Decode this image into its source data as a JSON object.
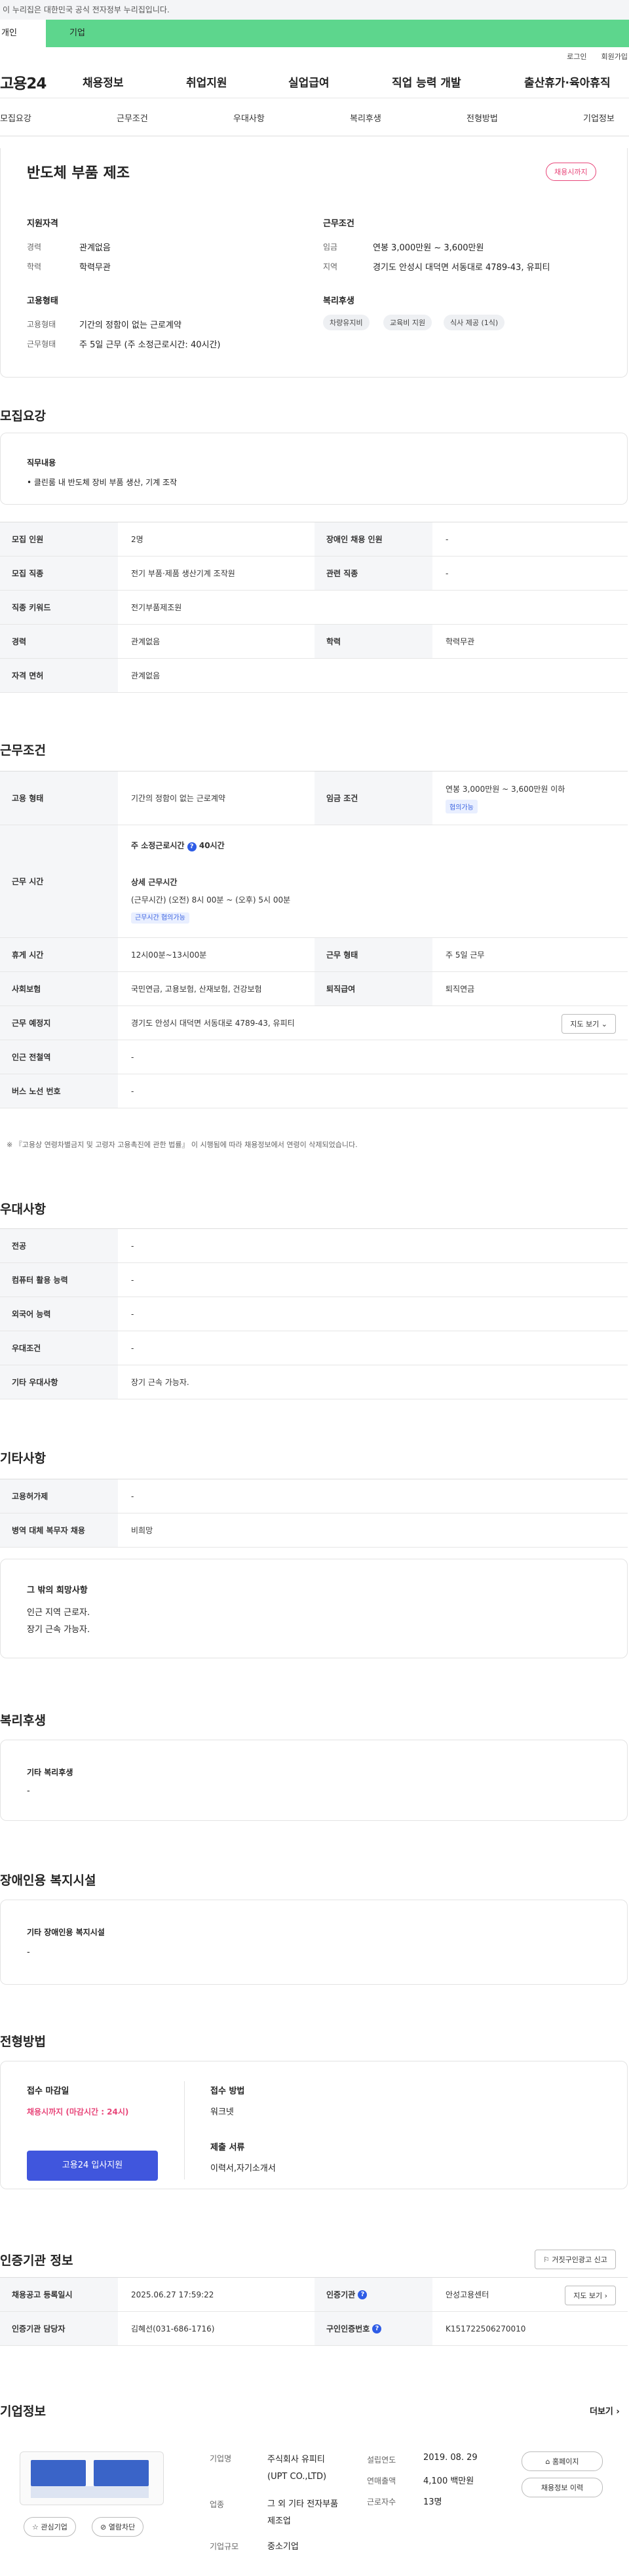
{
  "gov_banner": "이 누리집은 대한민국 공식 전자정부 누리집입니다.",
  "gov_tabs": [
    "개인",
    "기업"
  ],
  "util": [
    "로그인",
    "회원가입"
  ],
  "logo": "고용24",
  "menu": [
    "채용정보",
    "취업지원",
    "실업급여",
    "직업 능력 개발",
    "출산휴가·육아휴직"
  ],
  "subnav": [
    "모집요강",
    "근무조건",
    "우대사항",
    "복리후생",
    "전형방법",
    "기업정보"
  ],
  "hero": {
    "title": "반도체 부품 제조",
    "badge": "채용시까지",
    "support_h": "지원자격",
    "support": [
      {
        "k": "경력",
        "v": "관계없음"
      },
      {
        "k": "학력",
        "v": "학력무관"
      }
    ],
    "cond_h": "근무조건",
    "cond": [
      {
        "k": "임금",
        "v": "연봉 3,000만원 ~ 3,600만원"
      },
      {
        "k": "지역",
        "v": "경기도 안성시 대덕면 서동대로 4789-43, 유피티"
      }
    ],
    "emp_h": "고용형태",
    "emp": [
      {
        "k": "고용형태",
        "v": "기간의 정함이 없는 근로계약"
      },
      {
        "k": "근무형태",
        "v": "주 5일 근무 (주 소정근로시간: 40시간)"
      }
    ],
    "welfare_h": "복리후생",
    "welfare": [
      "차량유지비",
      "교육비 지원",
      "식사 제공 (1식)"
    ]
  },
  "recruit": {
    "title": "모집요강",
    "duty_h": "직무내용",
    "duty": "• 클린룸 내 반도체 장비 부품 생산, 기계 조작",
    "rows": [
      [
        "모집 인원",
        "2명",
        "장애인 채용 인원",
        "-"
      ],
      [
        "모집 직종",
        "전기 부품·제품 생산기계 조작원",
        "관련 직종",
        "-"
      ],
      [
        "직종 키워드",
        "전기부품제조원"
      ],
      [
        "경력",
        "관계없음",
        "학력",
        "학력무관"
      ],
      [
        "자격 면허",
        "관계없음"
      ]
    ]
  },
  "work": {
    "title": "근무조건",
    "emp_type_k": "고용 형태",
    "emp_type_v": "기간의 정함이 없는 근로계약",
    "wage_k": "임금 조건",
    "wage_v": "연봉 3,000만원 ~ 3,600만원 이하",
    "wage_tag": "협의가능",
    "hours_k": "근무 시간",
    "hours_week": "주 소정근로시간",
    "hours_week_v": "40시간",
    "hours_detail_h": "상세 근무시간",
    "hours_detail": "(근무시간) (오전) 8시 00분 ~ (오후) 5시 00분",
    "hours_tag": "근무시간 협의가능",
    "rows": [
      [
        "휴게 시간",
        "12시00분~13시00분",
        "근무 형태",
        "주 5일 근무"
      ],
      [
        "사회보험",
        "국민연금, 고용보험, 산재보험, 건강보험",
        "퇴직급여",
        "퇴직연금"
      ]
    ],
    "place_k": "근무 예정지",
    "place_v": "경기도 안성시 대덕면 서동대로 4789-43, 유피티",
    "map_btn": "지도 보기",
    "subway_k": "인근 전철역",
    "subway_v": "-",
    "bus_k": "버스 노선 번호",
    "bus_v": "-",
    "note": "※ 『고용상 연령차별금지 및 고령자 고용촉진에 관한 법률』 이 시행됨에 따라 채용정보에서 연령이 삭제되었습니다."
  },
  "pref": {
    "title": "우대사항",
    "rows": [
      [
        "전공",
        "-"
      ],
      [
        "컴퓨터 활용 능력",
        "-"
      ],
      [
        "외국어 능력",
        "-"
      ],
      [
        "우대조건",
        "-"
      ],
      [
        "기타 우대사항",
        "장기 근속 가능자."
      ]
    ]
  },
  "etc": {
    "title": "기타사항",
    "rows": [
      [
        "고용허가제",
        "-"
      ],
      [
        "병역 대체 복무자 채용",
        "비희망"
      ]
    ],
    "wish_h": "그 밖의 희망사항",
    "wish": [
      "인근 지역 근로자.",
      "장기 근속 가능자."
    ]
  },
  "benefit": {
    "title": "복리후생",
    "h": "기타 복리후생",
    "v": "-"
  },
  "disab": {
    "title": "장애인용 복지시설",
    "h": "기타 장애인용 복지시설",
    "v": "-"
  },
  "select": {
    "title": "전형방법",
    "deadline_h": "접수 마감일",
    "deadline": "채용시까지 (마감시간 : 24시)",
    "apply": "고용24 입사지원",
    "method_h": "접수 방법",
    "method": "워크넷",
    "docs_h": "제출 서류",
    "docs": "이력서,자기소개서"
  },
  "agency": {
    "title": "인증기관 정보",
    "report": "거짓구인광고 신고",
    "rows": [
      [
        "채용공고 등록일시",
        "2025.06.27 17:59:22",
        "인증기관",
        "안성고용센터"
      ],
      [
        "인증기관 담당자",
        "김혜선(031-686-1716)",
        "구인인증번호",
        "K151722506270010"
      ]
    ],
    "map_btn": "지도 보기"
  },
  "company": {
    "title": "기업정보",
    "more": "더보기",
    "like": "관심기업",
    "block": "열람차단",
    "name_k": "기업명",
    "name_v": "주식회사 유피티 (UPT CO.,LTD)",
    "ind_k": "업종",
    "ind_v": "그 외 기타 전자부품 제조업",
    "size_k": "기업규모",
    "size_v": "중소기업",
    "year_k": "설립연도",
    "year_v": "2019. 08. 29",
    "sales_k": "연매출액",
    "sales_v": "4,100 백만원",
    "emp_k": "근로자수",
    "emp_v": "13명",
    "home": "홈페이지",
    "history": "채용정보 이력"
  }
}
